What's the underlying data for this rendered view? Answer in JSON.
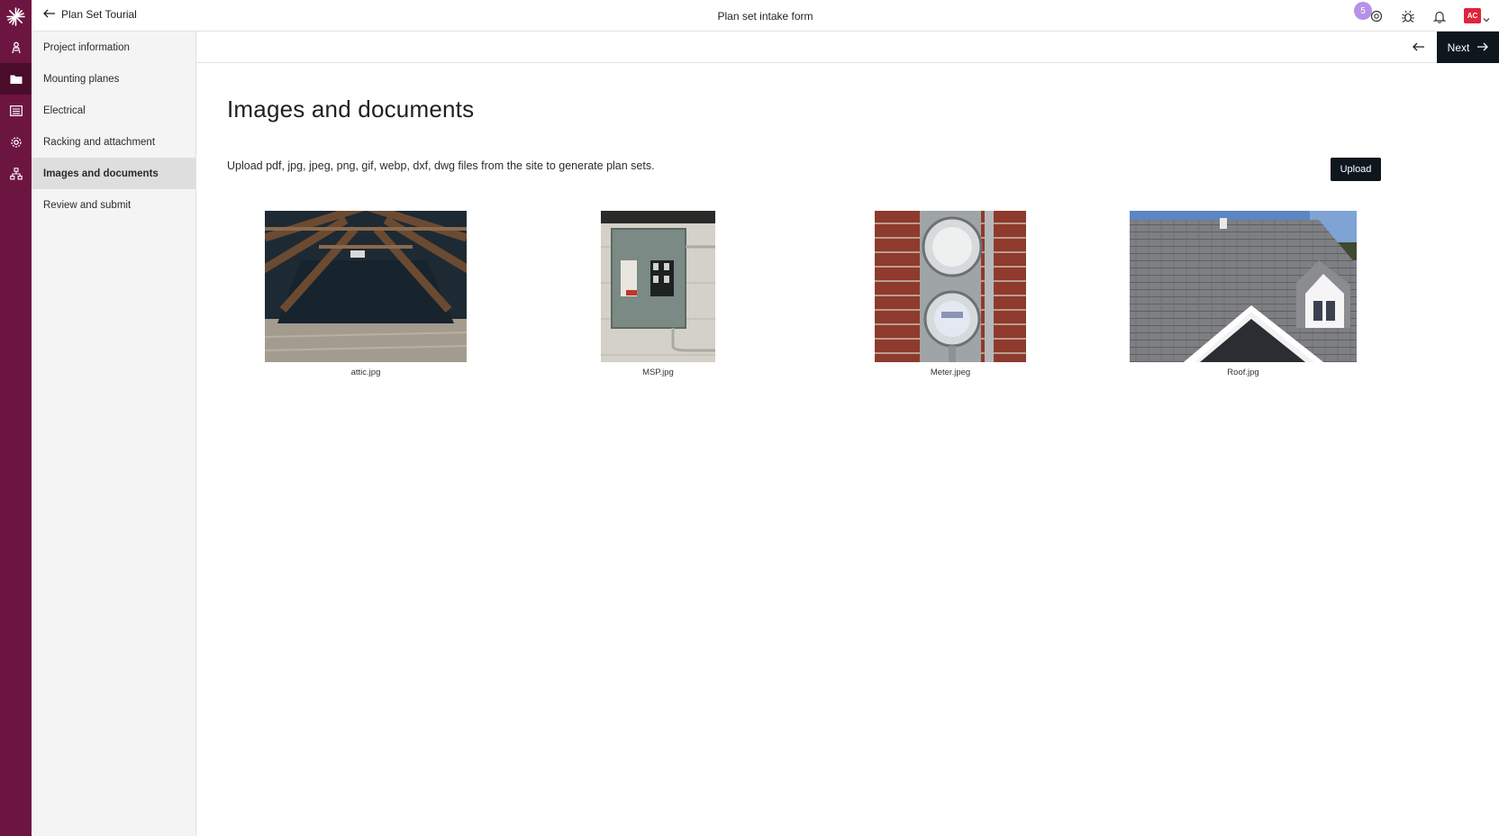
{
  "header": {
    "back_label": "Plan Set Tourial",
    "title": "Plan set intake form",
    "badge_count": "5",
    "avatar_initials": "AC"
  },
  "rail": {
    "icons": [
      "logo-icon",
      "person-icon",
      "folder-icon",
      "list-icon",
      "settings-icon",
      "sitemap-icon"
    ],
    "active": "folder-icon"
  },
  "sidebar": {
    "items": [
      {
        "label": "Project information"
      },
      {
        "label": "Mounting planes"
      },
      {
        "label": "Electrical"
      },
      {
        "label": "Racking and attachment"
      },
      {
        "label": "Images and documents",
        "active": true
      },
      {
        "label": "Review and submit"
      }
    ]
  },
  "actionbar": {
    "next_label": "Next"
  },
  "main": {
    "title": "Images and documents",
    "description": "Upload pdf, jpg, jpeg, png, gif, webp, dxf, dwg files from the site to generate plan sets.",
    "upload_label": "Upload",
    "files": [
      {
        "name": "attic.jpg"
      },
      {
        "name": "MSP.jpg"
      },
      {
        "name": "Meter.jpeg"
      },
      {
        "name": "Roof.jpg"
      }
    ]
  },
  "colors": {
    "rail": "#6d1541",
    "rail_active": "#4a0c2b",
    "primary_button": "#0f171e",
    "badge": "#b592e8",
    "avatar": "#e0243a"
  }
}
